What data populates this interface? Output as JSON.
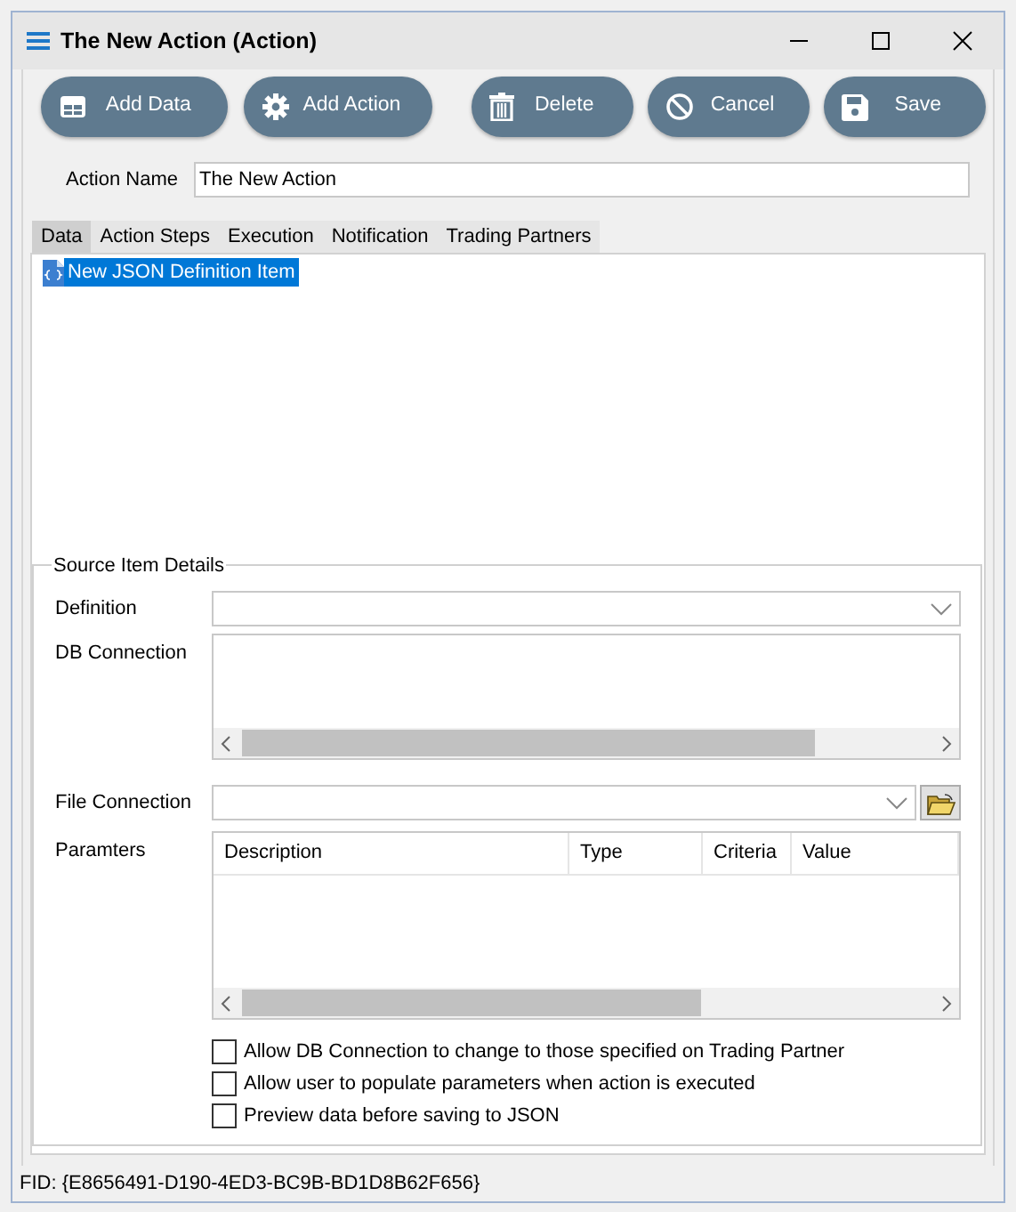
{
  "window": {
    "title": "The New Action (Action)"
  },
  "toolbar": {
    "buttons": [
      {
        "label": "Add Data",
        "kind": "grid"
      },
      {
        "label": "Add Action",
        "kind": "gear"
      },
      {
        "label": "Delete",
        "kind": "trash"
      },
      {
        "label": "Cancel",
        "kind": "cancel"
      },
      {
        "label": "Save",
        "kind": "save"
      }
    ]
  },
  "action_name": {
    "label": "Action Name",
    "value": "The New Action"
  },
  "tabs": [
    {
      "label": "Data",
      "selected": true
    },
    {
      "label": "Action Steps",
      "selected": false
    },
    {
      "label": "Execution",
      "selected": false
    },
    {
      "label": "Notification",
      "selected": false
    },
    {
      "label": "Trading Partners",
      "selected": false
    }
  ],
  "tree": {
    "items": [
      {
        "label": "New JSON Definition Item",
        "selected": true
      }
    ]
  },
  "source_item_details": {
    "title": "Source Item Details",
    "definition": {
      "label": "Definition"
    },
    "db_connection": {
      "label": "DB Connection"
    },
    "file_connection": {
      "label": "File Connection"
    },
    "parameters": {
      "label": "Paramters",
      "columns": [
        "Description",
        "Type",
        "Criteria",
        "Value"
      ]
    },
    "checkboxes": [
      {
        "label": "Allow DB Connection to change to those specified on Trading Partner",
        "checked": false
      },
      {
        "label": "Allow user to populate parameters when action is executed",
        "checked": false
      },
      {
        "label": "Preview data before saving to JSON",
        "checked": false
      }
    ]
  },
  "status_bar": {
    "text": "FID: {E8656491-D190-4ED3-BC9B-BD1D8B62F656}"
  }
}
